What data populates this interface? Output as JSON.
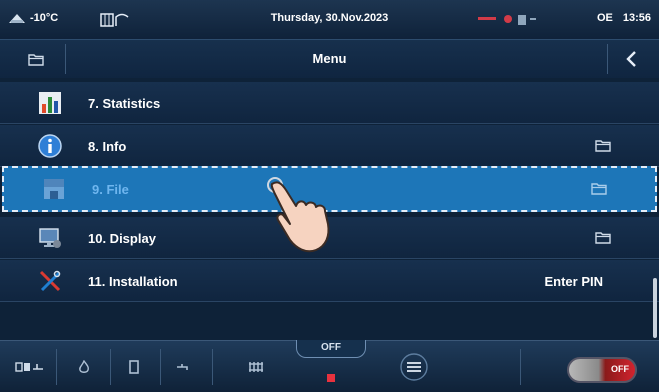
{
  "status": {
    "temperature": "-10°C",
    "datetime": "Thursday, 30.Nov.2023",
    "mode": "OE",
    "time": "13:56"
  },
  "header": {
    "title": "Menu"
  },
  "menu": {
    "items": [
      {
        "label": "7.  Statistics",
        "icon": "statistics-icon",
        "right": ""
      },
      {
        "label": "8.  Info",
        "icon": "info-icon",
        "right": "folder"
      },
      {
        "label": "9.  File",
        "icon": "file-icon",
        "right": "folder"
      },
      {
        "label": "10. Display",
        "icon": "display-icon",
        "right": "folder"
      },
      {
        "label": "11. Installation",
        "icon": "installation-icon",
        "right": "Enter PIN"
      }
    ]
  },
  "bottom": {
    "off_label": "OFF",
    "toggle_label": "OFF"
  },
  "colors": {
    "highlight": "#1d76b8",
    "alarm": "#d23b48"
  }
}
